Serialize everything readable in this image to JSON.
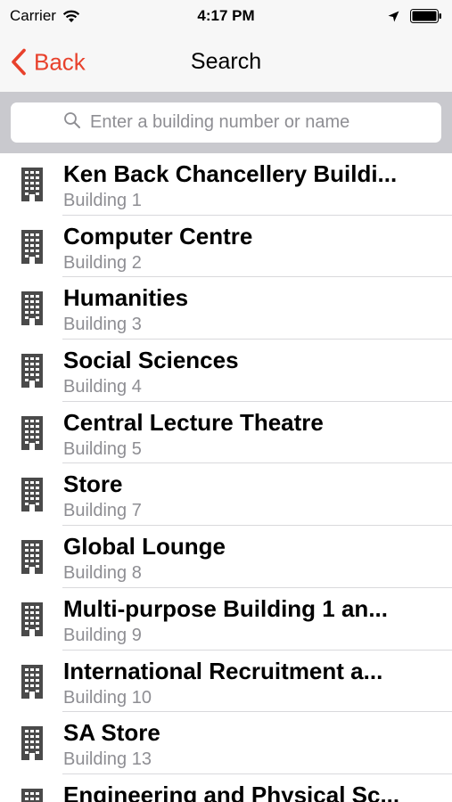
{
  "status_bar": {
    "carrier": "Carrier",
    "time": "4:17 PM"
  },
  "nav": {
    "back_label": "Back",
    "title": "Search"
  },
  "search": {
    "placeholder": "Enter a building number or name"
  },
  "colors": {
    "accent": "#e8412c",
    "secondary_text": "#8e8e93",
    "search_bar_bg": "#c9c9ce"
  },
  "buildings": [
    {
      "name": "Ken Back Chancellery Buildi...",
      "number": "Building 1"
    },
    {
      "name": "Computer Centre",
      "number": "Building 2"
    },
    {
      "name": "Humanities",
      "number": "Building 3"
    },
    {
      "name": "Social Sciences",
      "number": "Building 4"
    },
    {
      "name": "Central Lecture Theatre",
      "number": "Building 5"
    },
    {
      "name": "Store",
      "number": "Building 7"
    },
    {
      "name": "Global Lounge",
      "number": "Building 8"
    },
    {
      "name": "Multi-purpose Building 1 an...",
      "number": "Building 9"
    },
    {
      "name": "International Recruitment a...",
      "number": "Building 10"
    },
    {
      "name": "SA Store",
      "number": "Building 13"
    },
    {
      "name": "Engineering and Physical Sc...",
      "number": ""
    }
  ]
}
